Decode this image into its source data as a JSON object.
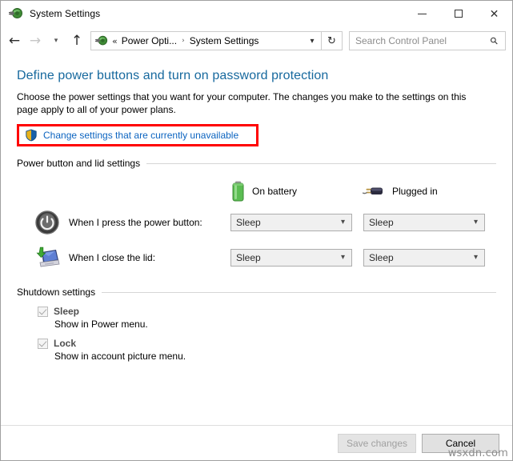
{
  "window": {
    "title": "System Settings",
    "icon": "power-options-icon",
    "controls": {
      "minimize": "minimize-button",
      "maximize": "maximize-button",
      "close": "close-button"
    }
  },
  "navbar": {
    "back": "back-arrow",
    "forward": "forward-arrow",
    "recent": "recent-locations-chevron",
    "up": "up-arrow",
    "breadcrumb": {
      "icon": "power-options-icon",
      "overflow": "«",
      "items": [
        "Power Opti...",
        "System Settings"
      ],
      "separator": "›",
      "dropdown": "chevron-down-icon"
    },
    "refresh": "↻",
    "search": {
      "placeholder": "Search Control Panel",
      "value": "",
      "icon": "search-icon"
    }
  },
  "page": {
    "title": "Define power buttons and turn on password protection",
    "description": "Choose the power settings that you want for your computer. The changes you make to the settings on this page apply to all of your power plans.",
    "admin_link": {
      "label": "Change settings that are currently unavailable",
      "icon": "uac-shield-icon",
      "highlight_color": "#ff0000"
    }
  },
  "power_lid_section": {
    "heading": "Power button and lid settings",
    "columns": [
      {
        "label": "On battery",
        "icon": "battery-icon"
      },
      {
        "label": "Plugged in",
        "icon": "power-plug-icon"
      }
    ],
    "rows": [
      {
        "icon": "power-button-icon",
        "label": "When I press the power button:",
        "on_battery": "Sleep",
        "plugged_in": "Sleep"
      },
      {
        "icon": "laptop-lid-icon",
        "label": "When I close the lid:",
        "on_battery": "Sleep",
        "plugged_in": "Sleep"
      }
    ]
  },
  "shutdown_section": {
    "heading": "Shutdown settings",
    "items": [
      {
        "label": "Sleep",
        "description": "Show in Power menu.",
        "checked": true,
        "enabled": false
      },
      {
        "label": "Lock",
        "description": "Show in account picture menu.",
        "checked": true,
        "enabled": false
      }
    ]
  },
  "footer": {
    "save_label": "Save changes",
    "cancel_label": "Cancel"
  },
  "watermark": "wsxdn.com",
  "colors": {
    "title_blue": "#17699e",
    "link_blue": "#0c64c0",
    "highlight_red": "#ff0000",
    "battery_green": "#5bbd52"
  }
}
